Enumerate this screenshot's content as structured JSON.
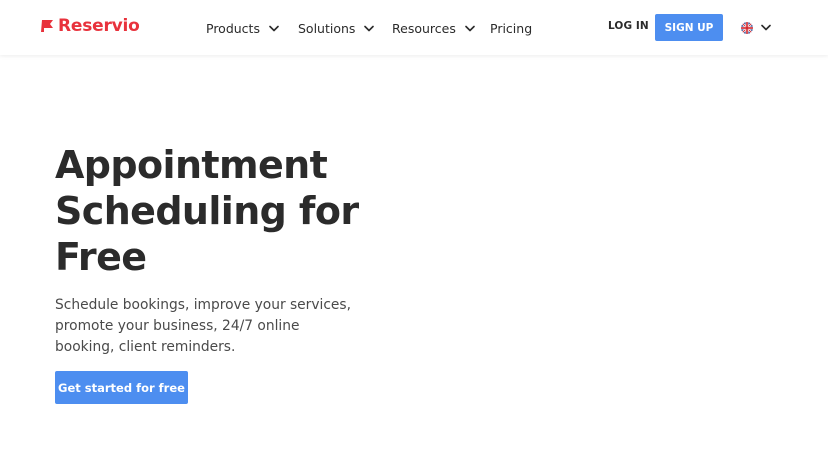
{
  "brand": {
    "name": "Reservio",
    "color": "#e8323c"
  },
  "nav": {
    "products": "Products",
    "solutions": "Solutions",
    "resources": "Resources",
    "pricing": "Pricing"
  },
  "auth": {
    "login_label": "LOG IN",
    "signup_label": "SIGN UP"
  },
  "language": {
    "icon": "uk-flag-icon"
  },
  "hero": {
    "title": "Appointment Scheduling for Free",
    "subtitle": "Schedule bookings, improve your services, promote your business, 24/7 online booking, client reminders.",
    "cta_label": "Get started for free"
  },
  "colors": {
    "accent": "#4d8ef0",
    "text": "#2b2b2b"
  }
}
